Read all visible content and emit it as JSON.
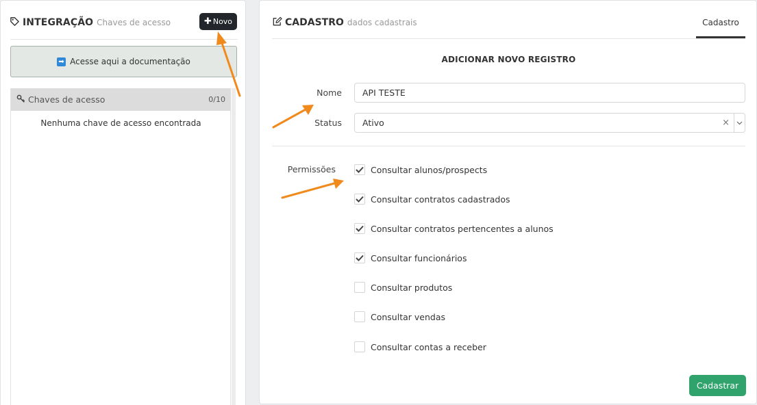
{
  "left": {
    "title": "INTEGRAÇÃO",
    "subtitle": "Chaves de acesso",
    "new_button": "Novo",
    "doc_button": "Acesse aqui a documentação",
    "keys_header": "Chaves de acesso",
    "keys_count": "0/10",
    "keys_empty": "Nenhuma chave de acesso encontrada"
  },
  "right": {
    "title": "CADASTRO",
    "subtitle": "dados cadastrais",
    "tab": "Cadastro",
    "form_title": "ADICIONAR NOVO REGISTRO",
    "name_label": "Nome",
    "name_value": "API TESTE",
    "status_label": "Status",
    "status_value": "Ativo",
    "perms_label": "Permissões",
    "permissions": [
      {
        "label": "Consultar alunos/prospects",
        "checked": true
      },
      {
        "label": "Consultar contratos cadastrados",
        "checked": true
      },
      {
        "label": "Consultar contratos pertencentes a alunos",
        "checked": true
      },
      {
        "label": "Consultar funcionários",
        "checked": true
      },
      {
        "label": "Consultar produtos",
        "checked": false
      },
      {
        "label": "Consultar vendas",
        "checked": false
      },
      {
        "label": "Consultar contas a receber",
        "checked": false
      }
    ],
    "submit_button": "Cadastrar"
  },
  "colors": {
    "accent_green": "#2fa36b",
    "dark_button": "#23272b",
    "annotation_orange": "#f08a1c"
  }
}
